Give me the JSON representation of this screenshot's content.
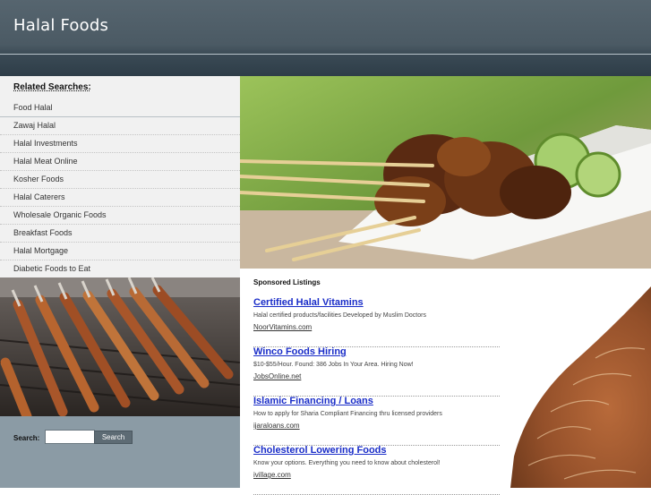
{
  "header": {
    "title": "Halal Foods"
  },
  "related": {
    "title": "Related Searches:",
    "items": [
      "Food Halal",
      "Zawaj Halal",
      "Halal Investments",
      "Halal Meat Online",
      "Kosher Foods",
      "Halal Caterers",
      "Wholesale Organic Foods",
      "Breakfast Foods",
      "Halal Mortgage",
      "Diabetic Foods to Eat"
    ]
  },
  "search": {
    "label": "Search:",
    "value": "",
    "button_label": "Search"
  },
  "sponsored": {
    "title": "Sponsored Listings",
    "listings": [
      {
        "title": "Certified Halal Vitamins",
        "desc": "Halal certified products/facilities Developed by Muslim Doctors",
        "url": "NoorVitamins.com"
      },
      {
        "title": "Winco Foods Hiring",
        "desc": "$10-$55/Hour. Found: 386 Jobs In Your Area. Hiring Now!",
        "url": "JobsOnline.net"
      },
      {
        "title": "Islamic Financing / Loans",
        "desc": "How to apply for Sharia Compliant Financing thru licensed providers",
        "url": "ijaraloans.com"
      },
      {
        "title": "Cholesterol Lowering Foods",
        "desc": "Know your options. Everything you need to know about cholesterol!",
        "url": "ivillage.com"
      }
    ]
  },
  "colors": {
    "header_top": "#56656f",
    "header_bottom": "#2e3d48",
    "link_blue": "#1a2dc8",
    "sidebar_bg": "#f1f1f1",
    "search_bg": "#8b9ba5"
  }
}
